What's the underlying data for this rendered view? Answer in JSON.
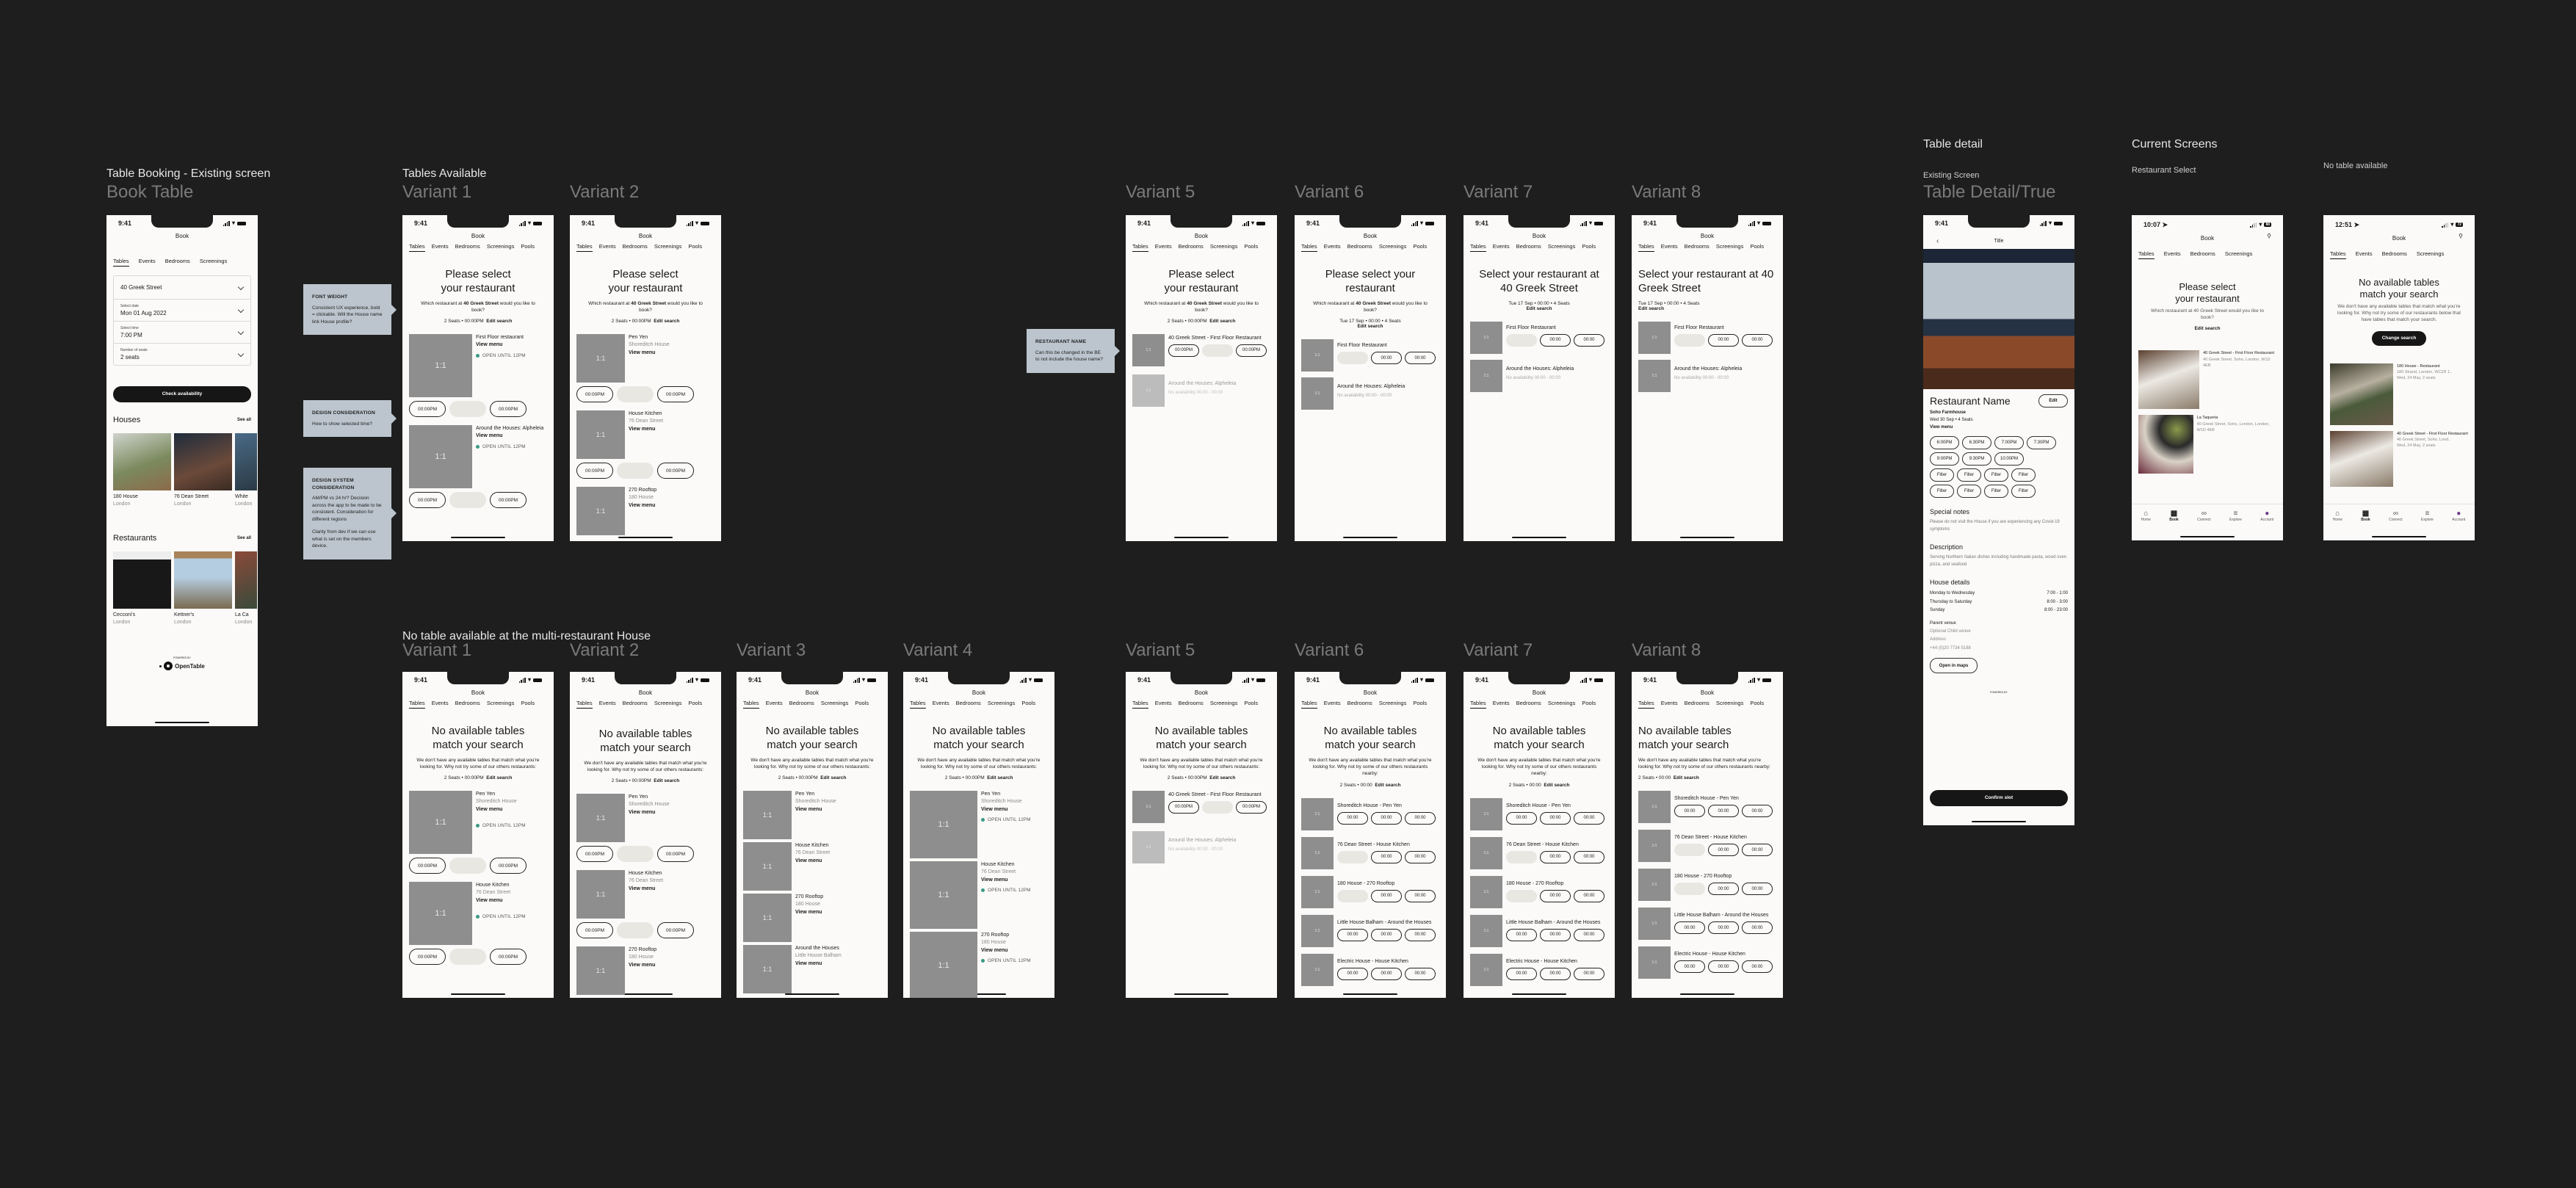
{
  "sections": {
    "existing_title": "Table Booking - Existing screen",
    "tables_available_title": "Tables Available",
    "no_table_multi_title": "No table available at the multi-restaurant House",
    "table_detail_title": "Table detail",
    "table_detail_sub": "Existing Screen",
    "current_screens_title": "Current Screens",
    "current_restaurant_select_sub": "Restaurant Select",
    "current_no_table_sub": "No table available"
  },
  "frame_labels": {
    "book_table": "Book Table",
    "v1": "Variant 1",
    "v2": "Variant 2",
    "v3": "Variant 3",
    "v4": "Variant 4",
    "v5": "Variant 5",
    "v6": "Variant 6",
    "v7": "Variant 7",
    "v8": "Variant 8",
    "table_detail": "Table Detail/True"
  },
  "common": {
    "time": "9:41",
    "page_title": "Book",
    "tabs": [
      "Tables",
      "Events",
      "Bedrooms",
      "Screenings",
      "Pools"
    ],
    "ratio": "1:1",
    "view_menu": "View menu",
    "open_until": "OPEN UNTIL 12PM",
    "edit_search": "Edit search",
    "slot_pm": "00:00PM",
    "slot_24": "00:00",
    "no_availability": "No availability 00:00 - 00:00"
  },
  "notes": [
    {
      "title": "FONT WEIGHT",
      "text": "Consistent UX experience, bold = clickable. Will the House name link House profile?"
    },
    {
      "title": "DESIGN CONSIDERATION",
      "text": "How to show selected time?"
    },
    {
      "title": "DESIGN SYSTEM CONSIDERATION",
      "text": "AM/PM vs 24 hr? Decision across the app to be made to be consistent. Consideration for different regions",
      "text2": "Clarity from dev if we can use what is set on the members device."
    },
    {
      "title": "RESTAURANT NAME",
      "text": "Can this be changed in the BE to not include the house name?"
    }
  ],
  "book_table": {
    "tabs": [
      "Tables",
      "Events",
      "Bedrooms",
      "Screenings"
    ],
    "location": "40 Greek Street",
    "date_label": "Select date",
    "date_value": "Mon 01 Aug 2022",
    "time_label": "Select time",
    "time_value": "7:00 PM",
    "seats_label": "Number of seats",
    "seats_value": "2 seats",
    "check_button": "Check availability",
    "houses_title": "Houses",
    "see_all": "See all",
    "houses": [
      {
        "name": "180 House",
        "city": "London"
      },
      {
        "name": "76 Dean Street",
        "city": "London"
      },
      {
        "name": "White",
        "city": "London"
      }
    ],
    "restaurants_title": "Restaurants",
    "restaurants": [
      {
        "name": "Cecconi's",
        "city": "London"
      },
      {
        "name": "Kettner's",
        "city": "London"
      },
      {
        "name": "La Ca",
        "city": "London"
      }
    ],
    "powered_by": "POWERED BY",
    "opentable": "OpenTable"
  },
  "select_restaurant": {
    "title": "Please select your restaurant",
    "title_l1": "Please select",
    "title_l2": "your restaurant",
    "title_v6_l1": "Please select your",
    "title_v6_l2": "restaurant",
    "title_v7": "Select your restaurant at 40 Greek Street",
    "question_pre": "Which restaurant at ",
    "question_bold": "40 Greek Street",
    "question_post": " would you like to book?",
    "meta_pm": "2 Seats • 00:00PM",
    "meta_date": "Tue 17 Sep • 00:00 • 4 Seats",
    "v1_items": [
      "First Floor restaurant",
      "Around the Houses: Alpheleia"
    ],
    "v2_items": [
      {
        "name": "Pen Yen",
        "house": "Shoreditch House"
      },
      {
        "name": "House Kitchen",
        "house": "76 Dean Street"
      },
      {
        "name": "270 Rooftop",
        "house": "180 House"
      }
    ],
    "v5_items": [
      "40 Greek Street - First Floor Restaurant",
      "Around the Houses: Alpheleia"
    ],
    "v6_items": [
      "First Floor Restaurant",
      "Around the Houses: Alpheleia"
    ]
  },
  "no_tables": {
    "title_l1": "No available tables",
    "title_l2": "match your search",
    "sub": "We don't have any available tables that match what you're looking for. Why not try some of our others restaurants:",
    "sub_nearby": "We don't have any available tables that match what you're looking for. Why not try some of our others restaurants nearby:",
    "meta_pm": "2 Seats • 00:00PM",
    "meta_24": "2 Seats • 00:00",
    "items": [
      {
        "name": "Pen Yen",
        "house": "Shoreditch House"
      },
      {
        "name": "House Kitchen",
        "house": "76 Dean Street"
      },
      {
        "name": "270 Rooftop",
        "house": "180 House"
      },
      {
        "name": "Around the Houses",
        "house": "Little House Balham"
      }
    ],
    "combined_items": [
      "Shoreditch House - Pen Yen",
      "76 Dean Street - House Kitchen",
      "180 House - 270 Rooftop",
      "Little House Balham - Around the Houses",
      "Electric House - House Kitchen"
    ]
  },
  "table_detail": {
    "nav_title": "Title",
    "restaurant_name": "Restaurant Name",
    "edit": "Edit",
    "house": "Soho Farmhouse",
    "date_seats": "Wed 30 Sep • 4 Seats",
    "view_menu": "View menu",
    "times": [
      "6:00PM",
      "6:30PM",
      "7:00PM",
      "7:30PM",
      "9:00PM",
      "9:30PM",
      "10:00PM"
    ],
    "filter": "Filter",
    "special_notes_title": "Special notes",
    "special_notes": "Please do not visit the House if you are experiencing any Covid-19 symptoms",
    "description_title": "Description",
    "description": "Serving Northern Italian dishes including handmade pasta, wood oven pizza, and seafood",
    "house_details_title": "House details",
    "hours": [
      {
        "days": "Monday to Wednesday",
        "time": "7:00 - 1:00"
      },
      {
        "days": "Thursday to Saturday",
        "time": "8:00 - 3:00"
      },
      {
        "days": "Sunday",
        "time": "8:00 - 23:00"
      }
    ],
    "parent_venue": "Parent venue",
    "child_venue": "Optional Child venue",
    "address": "Address",
    "phone": "+44 (0)20 7734 5188",
    "open_maps": "Open in maps",
    "powered_by": "POWERED BY",
    "confirm": "Confirm slot"
  },
  "current_select": {
    "time": "10:07",
    "battery": "88",
    "title_l1": "Please select",
    "title_l2": "your restaurant",
    "question": "Which restaurant at 40 Greek Street would you like to book?",
    "edit_search": "Edit search",
    "items": [
      {
        "name": "40 Greek Street - First Floor Restaurant",
        "address": "40 Greek Street, Soho, London, W1D 4EB"
      },
      {
        "name": "La Taqueria",
        "address": "40 Greek Street, Soho, London, London, W1D 4EB"
      }
    ]
  },
  "current_none": {
    "time": "12:51",
    "battery": "72",
    "title_l1": "No available tables",
    "title_l2": "match your search",
    "sub": "We don't have any available tables that match what you're looking for. Why not try some of our restaurants below that have tables that match your search.",
    "change_search": "Change search",
    "items": [
      {
        "name": "180 House - Restaurant",
        "address": "180 Strand, London, WC2R 1..",
        "date": "Wed, 24 May, 2 seats"
      },
      {
        "name": "40 Greek Street - First Floor Restaurant",
        "address": "40 Greek Street, Soho, Lond..",
        "date": "Wed, 24 May, 2 seats"
      }
    ]
  },
  "bottom_nav": [
    "Home",
    "Book",
    "Connect",
    "Explore",
    "Account"
  ],
  "colors": {
    "canvas": "#1e1e1e",
    "screen": "#fbfaf8",
    "note": "#bcc5ce",
    "open_dot": "#3a9a86",
    "placeholder": "#8e8e8e"
  }
}
